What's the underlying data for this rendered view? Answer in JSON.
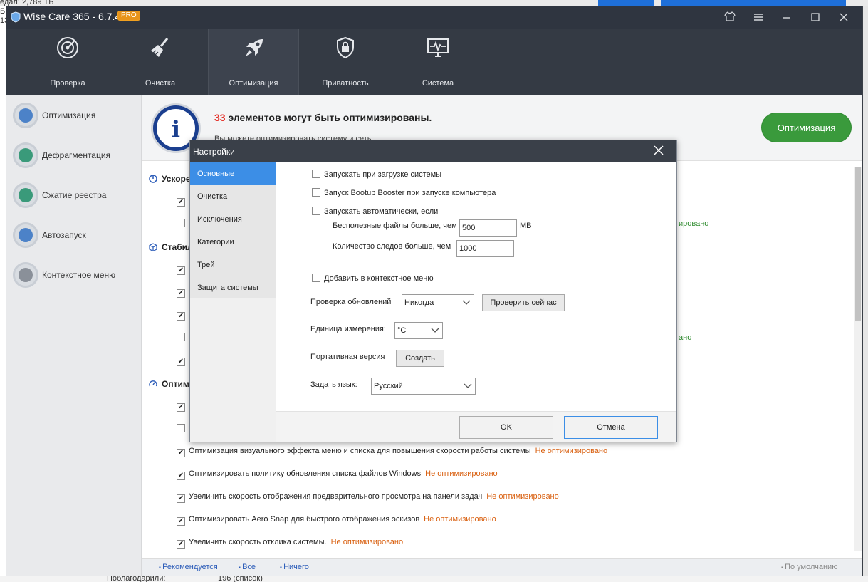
{
  "background": {
    "top_left_lines": [
      "едал: 2,789 ТБ",
      "Б",
      "13"
    ],
    "bottom_label": "Поблагодарили:",
    "bottom_value": "196   (список)"
  },
  "window": {
    "title": "Wise Care 365 - 6.7.4",
    "badge": "PRO",
    "controls": {
      "skin": "shirt-icon",
      "menu": "menu-icon",
      "minimize": "minimize-icon",
      "maximize": "maximize-icon",
      "close": "close-icon"
    }
  },
  "topnav": [
    {
      "label": "Проверка",
      "icon": "radar-icon"
    },
    {
      "label": "Очистка",
      "icon": "broom-icon"
    },
    {
      "label": "Оптимизация",
      "icon": "rocket-icon",
      "active": true
    },
    {
      "label": "Приватность",
      "icon": "lock-icon"
    },
    {
      "label": "Система",
      "icon": "monitor-icon"
    }
  ],
  "sidebar": [
    {
      "label": "Оптимизация",
      "icon": "gear-icon"
    },
    {
      "label": "Дефрагментация",
      "icon": "disk-icon"
    },
    {
      "label": "Сжатие реестра",
      "icon": "registry-icon"
    },
    {
      "label": "Автозапуск",
      "icon": "play-icon"
    },
    {
      "label": "Контекстное меню",
      "icon": "mouse-icon"
    }
  ],
  "banner": {
    "count": "33",
    "title_rest": " элементов могут быть оптимизированы.",
    "subtitle": "Вы можете оптимизировать систему и сеть.",
    "button": "Оптимизация"
  },
  "sections": [
    {
      "title": "Ускоре"
    },
    {
      "title": "Стабил"
    },
    {
      "title": "Оптим"
    }
  ],
  "partial_rows": [
    "У",
    "С",
    "С",
    "С",
    "С",
    "А",
    "А",
    "У",
    "С"
  ],
  "visible_rows": [
    {
      "text": "Оптимизация визуального эффекта меню и списка для повышения скорости работы системы",
      "status": "Не оптимизировано"
    },
    {
      "text": "Оптимизировать политику обновления списка файлов Windows",
      "status": "Не оптимизировано"
    },
    {
      "text": "Увеличить скорость отображения предварительного просмотра на панели задач",
      "status": "Не оптимизировано"
    },
    {
      "text": "Оптимизировать Aero Snap для быстрого отображения эскизов",
      "status": "Не оптимизировано"
    },
    {
      "text": "Увеличить скорость отклика системы.",
      "status": "Не оптимизировано"
    }
  ],
  "right_statuses": [
    "ировано",
    "ано"
  ],
  "footer": {
    "recommended": "Рекомендуется",
    "all": "Все",
    "none": "Ничего",
    "default": "По умолчанию"
  },
  "dialog": {
    "title": "Настройки",
    "nav": [
      "Основные",
      "Очистка",
      "Исключения",
      "Категории",
      "Трей",
      "Защита системы"
    ],
    "options": {
      "startup": "Запускать при загрузке системы",
      "bootup_booster": "Запуск Bootup Booster при запуске компьютера",
      "auto_run_if": "Запускать автоматически, если",
      "junk_label": "Бесполезные файлы больше, чем",
      "junk_value": "500",
      "junk_unit": "MB",
      "traces_label": "Количество следов больше, чем",
      "traces_value": "1000",
      "context_menu": "Добавить в контекстное меню"
    },
    "update_check": {
      "label": "Проверка обновлений",
      "value": "Никогда",
      "button": "Проверить сейчас"
    },
    "unit": {
      "label": "Единица измерения:",
      "value": "°C"
    },
    "portable": {
      "label": "Портативная версия",
      "button": "Создать"
    },
    "language": {
      "label": "Задать язык:",
      "value": "Русский"
    },
    "ok": "OK",
    "cancel": "Отмена"
  }
}
